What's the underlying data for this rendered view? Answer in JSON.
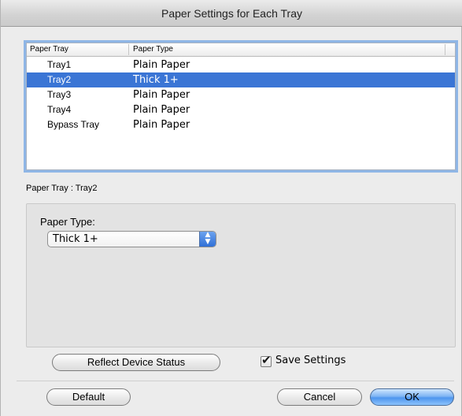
{
  "window": {
    "title": "Paper Settings for Each Tray"
  },
  "table": {
    "headers": {
      "tray": "Paper Tray",
      "type": "Paper Type"
    },
    "rows": [
      {
        "tray": "Tray1",
        "type": "Plain Paper",
        "selected": false
      },
      {
        "tray": "Tray2",
        "type": "Thick 1+",
        "selected": true
      },
      {
        "tray": "Tray3",
        "type": "Plain Paper",
        "selected": false
      },
      {
        "tray": "Tray4",
        "type": "Plain Paper",
        "selected": false
      },
      {
        "tray": "Bypass Tray",
        "type": "Plain Paper",
        "selected": false
      }
    ]
  },
  "selection_label": "Paper Tray : Tray2",
  "paper_type_group": {
    "label": "Paper Type:",
    "selected_value": "Thick 1+"
  },
  "buttons": {
    "reflect": "Reflect Device Status",
    "default": "Default",
    "cancel": "Cancel",
    "ok": "OK"
  },
  "save_settings": {
    "label": "Save Settings",
    "checked": true
  },
  "colors": {
    "selection": "#3a75d5",
    "focus_ring": "#8fb6e6"
  }
}
